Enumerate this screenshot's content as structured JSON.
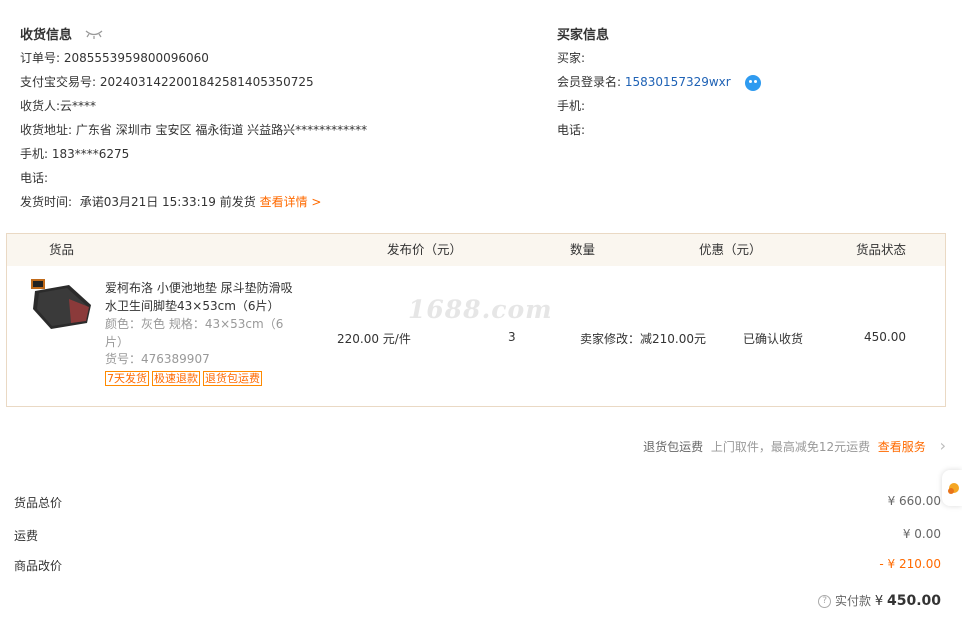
{
  "shipping": {
    "title": "收货信息",
    "order_no_label": "订单号:",
    "order_no": "2085553959800096060",
    "alipay_label": "支付宝交易号:",
    "alipay_no": "2024031422001842581405350725",
    "receiver_label": "收货人:",
    "receiver": "云****",
    "address_label": "收货地址:",
    "address": "广东省 深圳市 宝安区 福永街道 兴益路兴************",
    "mobile_label": "手机:",
    "mobile": "183****6275",
    "phone_label": "电话:",
    "ship_time_label": "发货时间:",
    "ship_time": "承诺03月21日 15:33:19 前发货",
    "detail_link": "查看详情 >"
  },
  "buyer": {
    "title": "买家信息",
    "buyer_label": "买家:",
    "member_label": "会员登录名:",
    "member": "15830157329wxr",
    "mobile_label": "手机:",
    "phone_label": "电话:"
  },
  "table": {
    "headers": {
      "goods": "货品",
      "price": "发布价（元）",
      "qty": "数量",
      "discount": "优惠（元）",
      "status": "货品状态"
    },
    "item": {
      "title": "爱柯布洛 小便池地垫 尿斗垫防滑吸水卫生间脚垫43×53cm（6片）",
      "spec": "颜色：灰色   规格：43×53cm（6片）",
      "sku": "货号：476389907",
      "tags": [
        "7天发货",
        "极速退款",
        "退货包运费"
      ],
      "price": "220.00 元/件",
      "qty": "3",
      "discount": "卖家修改：减210.00元",
      "status": "已确认收货",
      "amount": "450.00"
    },
    "watermark": "1688.com"
  },
  "service": {
    "title": "退货包运费",
    "desc": "上门取件，最高减免12元运费",
    "link": "查看服务"
  },
  "summary": {
    "goods_total_label": "货品总价",
    "goods_total": "¥ 660.00",
    "shipping_label": "运费",
    "shipping": "¥ 0.00",
    "adjust_label": "商品改价",
    "adjust": "- ¥ 210.00",
    "paid_label": "实付款",
    "paid_currency": "¥",
    "paid": "450.00"
  },
  "colors": {
    "accent": "#ff6a00",
    "link_blue": "#1f62b5",
    "table_header_bg": "#faf6ef",
    "table_border": "#ead9c4"
  }
}
